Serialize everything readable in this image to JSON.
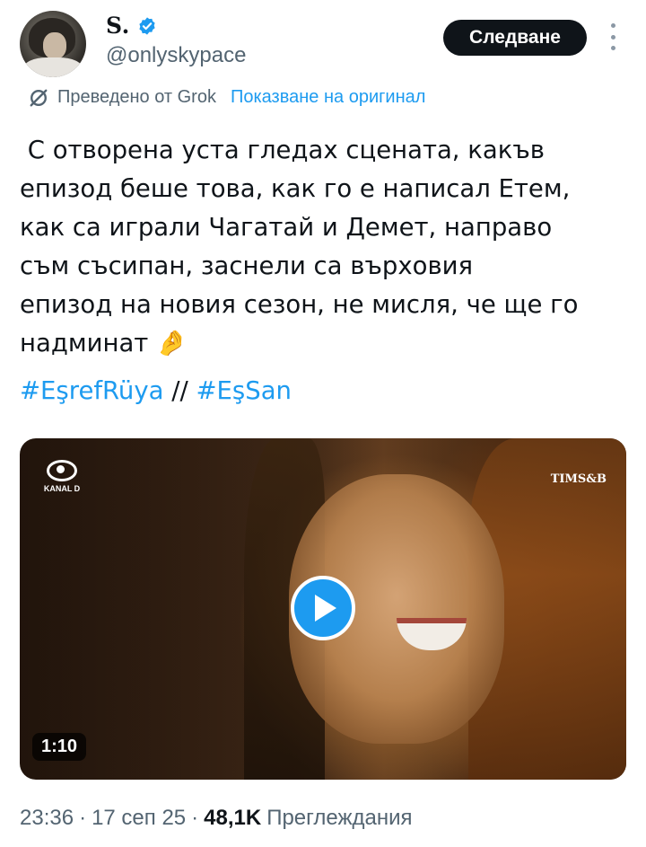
{
  "author": {
    "display_name": "S.",
    "handle": "@onlyskypace",
    "verified": true
  },
  "header": {
    "follow_label": "Следване"
  },
  "translation": {
    "translated_by": "Преведено от Grok",
    "show_original": "Показване на оригинал"
  },
  "tweet": {
    "text": " С отворена уста гледах сцената, какъв\nепизод беше това, как го е написал Етем,\nкак са играли Чагатай и Демет, направо\nсъм съсипан, заснели са върховия\nепизод на новия сезон, не мисля, че ще го\nнадминат 🤌",
    "hashtag1": "#EşrefRüya",
    "separator": " // ",
    "hashtag2": "#EşSan"
  },
  "media": {
    "channel_logo": "KANAL D",
    "producer_logo": "TIMS&B",
    "duration": "1:10"
  },
  "meta": {
    "time": "23:36",
    "dot": "·",
    "date": "17 сеп 25",
    "views_count": "48,1K",
    "views_label": "Преглеждания"
  },
  "colors": {
    "accent": "#1d9bf0",
    "text_primary": "#0f1419",
    "text_secondary": "#536471"
  }
}
